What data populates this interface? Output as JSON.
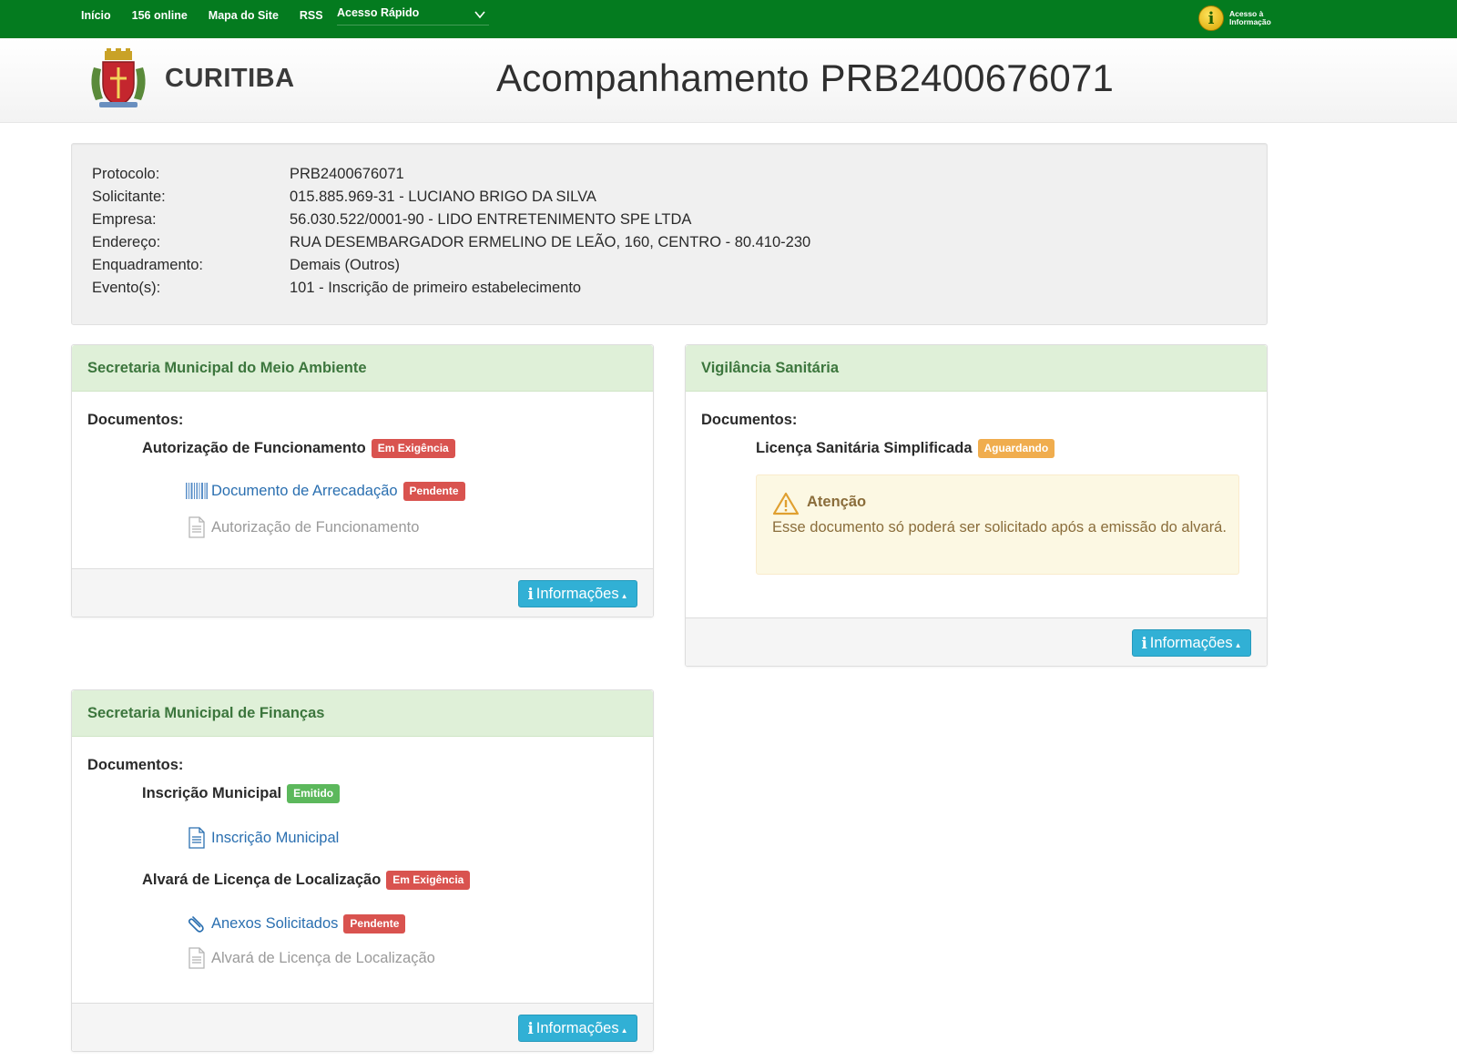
{
  "topbar": {
    "nav": [
      "Início",
      "156 online",
      "Mapa do Site",
      "RSS"
    ],
    "quick_access": "Acesso Rápido",
    "info_access_line1": "Acesso à",
    "info_access_line2": "Informação",
    "color": "#047b1f"
  },
  "header": {
    "city": "CURITIBA",
    "title": "Acompanhamento PRB2400676071"
  },
  "summary": [
    {
      "label": "Protocolo:",
      "value": "PRB2400676071"
    },
    {
      "label": "Solicitante:",
      "value": "015.885.969-31 - LUCIANO BRIGO DA SILVA"
    },
    {
      "label": "Empresa:",
      "value": "56.030.522/0001-90 - LIDO ENTRETENIMENTO SPE LTDA"
    },
    {
      "label": "Endereço:",
      "value": "RUA DESEMBARGADOR ERMELINO DE LEÃO, 160, CENTRO - 80.410-230"
    },
    {
      "label": "Enquadramento:",
      "value": "Demais (Outros)"
    },
    {
      "label": "Evento(s):",
      "value": "101 - Inscrição de primeiro estabelecimento"
    }
  ],
  "panels": {
    "meio_ambiente": {
      "title": "Secretaria Municipal do Meio Ambiente",
      "docs_label": "Documentos:",
      "doc1": {
        "title": "Autorização de Funcionamento",
        "status": "Em Exigência"
      },
      "item1": {
        "label": "Documento de Arrecadação",
        "status": "Pendente",
        "icon": "barcode-icon"
      },
      "item2": {
        "label": "Autorização de Funcionamento",
        "icon": "document-icon"
      },
      "button": "Informações"
    },
    "vigilancia": {
      "title": "Vigilância Sanitária",
      "docs_label": "Documentos:",
      "doc1": {
        "title": "Licença Sanitária Simplificada",
        "status": "Aguardando"
      },
      "alert": {
        "title": "Atenção",
        "text": "Esse documento só poderá ser solicitado após a emissão do alvará.",
        "icon": "warning-icon"
      },
      "button": "Informações"
    },
    "financas": {
      "title": "Secretaria Municipal de Finanças",
      "docs_label": "Documentos:",
      "doc1": {
        "title": "Inscrição Municipal",
        "status": "Emitido"
      },
      "item1": {
        "label": "Inscrição Municipal",
        "icon": "document-icon"
      },
      "doc2": {
        "title": "Alvará de Licença de Localização",
        "status": "Em Exigência"
      },
      "item2": {
        "label": "Anexos Solicitados",
        "status": "Pendente",
        "icon": "paperclip-icon"
      },
      "item3": {
        "label": "Alvará de Licença de Localização",
        "icon": "document-icon"
      },
      "button": "Informações"
    }
  },
  "colors": {
    "panel_header_bg": "#dff0d8",
    "panel_header_text": "#3c763d",
    "badge_danger": "#d9534f",
    "badge_warning": "#f0ad4e",
    "badge_success": "#5cb85c",
    "button_info": "#31b0d5",
    "link": "#2a6fb0"
  }
}
